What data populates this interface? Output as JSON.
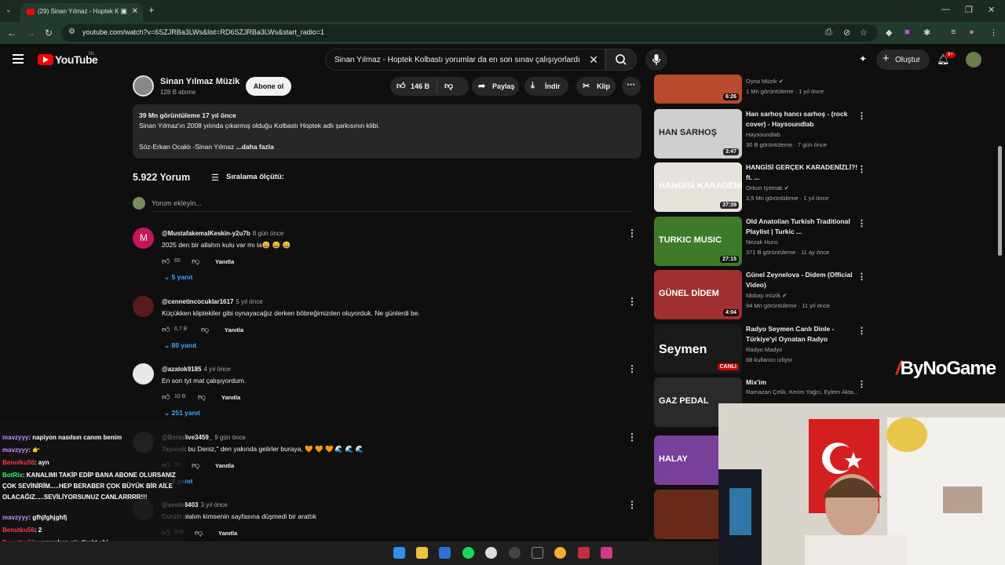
{
  "browser": {
    "tab_title": "(29) Sinan Yılmaz - Hoptek K",
    "url": "youtube.com/watch?v=6SZJRBa3LWs&list=RD6SZJRBa3LWs&start_radio=1"
  },
  "header": {
    "logo_text": "YouTube",
    "country": "NL",
    "search_query": "Sinan Yılmaz - Hoptek Kolbastı yorumlar da en son sınav çalışıyorlardı",
    "create_label": "Oluştur",
    "notif_count": "9+"
  },
  "channel": {
    "name": "Sinan Yılmaz Müzik",
    "subs": "128 B abone",
    "subscribe": "Abone ol",
    "likes": "146 B",
    "share": "Paylaş",
    "download": "İndir",
    "clip": "Klip"
  },
  "description": {
    "stats": "39 Mn görüntüleme  17 yıl önce",
    "line1": "Sinan Yılmaz'ın 2008 yılında çıkarmış olduğu  Kolbastı Hoptek adlı şarkısının klibi.",
    "line2": "Söz-Erkan Ocaklı -Sinan Yılmaz",
    "more": "...daha fazla"
  },
  "comments_section": {
    "count": "5.922 Yorum",
    "sort": "Sıralama ölçütü:",
    "add_placeholder": "Yorum ekleyin...",
    "reply_label": "Yanıtla"
  },
  "comments": [
    {
      "author": "@MustafakemalKeskin-y2u7b",
      "time": "8 gün önce",
      "text": "2025 den bir allahın kulu var mı la😄 😄 😄",
      "likes": "65",
      "replies": "5 yanıt",
      "avatar_color": "#c2185b",
      "avatar_letter": "M"
    },
    {
      "author": "@cennetincocuklar1617",
      "time": "5 yıl önce",
      "text": "Küçükken kliptekiler gibi oynayacağız derken böbreğimizden oluyorduk. Ne günlerdi be.",
      "likes": "6,7 B",
      "replies": "80 yanıt",
      "avatar_color": "#5a1a1a",
      "avatar_letter": ""
    },
    {
      "author": "@azatok9185",
      "time": "4 yıl önce",
      "text": "En son tyt mat çalışıyordum.",
      "likes": "10 B",
      "replies": "251 yanıt",
      "avatar_color": "#e8e8e8",
      "avatar_letter": ""
    },
    {
      "author": "@Bertolive3459_",
      "time": "9 gün önce",
      "text": "Taşacak bu Deniz,\" den yakında gelirler buraya, 🧡 🧡 🧡 🌊 🌊 🌊",
      "likes": "55",
      "replies": "4 yanıt",
      "avatar_color": "#444",
      "avatar_letter": ""
    },
    {
      "author": "@avolo8403",
      "time": "3 yıl önce",
      "text": "Dürüst olalım kimsenin sayfasına düşmedi bir arattık",
      "likes": "979",
      "replies": "",
      "avatar_color": "#333",
      "avatar_letter": ""
    }
  ],
  "sidebar_videos": [
    {
      "title": "",
      "channel": "Oyna Müzik",
      "verified": true,
      "meta": "1 Mn görüntüleme · 1 yıl önce",
      "duration": "6:26",
      "thumb_color": "#b94a2e",
      "thumb_text": ""
    },
    {
      "title": "Han sarhoş hancı sarhoş - (rock cover) - Haysoundlab",
      "channel": "Haysoundlab",
      "verified": false,
      "meta": "30 B görüntüleme · 7 gün önce",
      "duration": "3:47",
      "thumb_color": "#cfcfcf",
      "thumb_text": "HAN SARHOŞ"
    },
    {
      "title": "HANGİSİ GERÇEK KARADENİZLİ?! ft. ...",
      "channel": "Orkun Işıtmak",
      "verified": true,
      "meta": "3,5 Mn görüntüleme · 1 yıl önce",
      "duration": "37:39",
      "thumb_color": "#e8e2dc",
      "thumb_text": "HANGİSİ KARADENİZLİ"
    },
    {
      "title": "Old Anatolian Turkish Traditional Playlist | Turkic ...",
      "channel": "Nezak Huns",
      "verified": false,
      "meta": "371 B görüntüleme · 11 ay önce",
      "duration": "27:15",
      "thumb_color": "#3f7a2a",
      "thumb_text": "TURKIC MUSIC"
    },
    {
      "title": "Günel Zeynelova - Didem (Official Video)",
      "channel": "Idobay müzik",
      "verified": true,
      "meta": "94 Mn görüntüleme · 11 yıl önce",
      "duration": "4:04",
      "thumb_color": "#a03030",
      "thumb_text": "GÜNEL DİDEM"
    },
    {
      "title": "Radyo Seymen Canlı Dinle - Türkiye'yi Oynatan Radyo",
      "channel": "Radyo Madyo",
      "verified": false,
      "meta": "88 kullanıcı izliyor",
      "duration": "CANLI",
      "thumb_color": "#1a1a1a",
      "thumb_text": "Seymen"
    },
    {
      "title": "Mix'im",
      "channel": "Ramazan Çelik, Kerim Yağcı, Eylem Akta...",
      "verified": false,
      "meta": "",
      "duration": "",
      "thumb_color": "#2a2a2a",
      "thumb_text": "GAZ PEDAL"
    },
    {
      "title": "",
      "channel": "",
      "verified": false,
      "meta": "",
      "duration": "",
      "thumb_color": "#7a3f9a",
      "thumb_text": "HALAY"
    },
    {
      "title": "",
      "channel": "",
      "verified": false,
      "meta": "",
      "duration": "",
      "thumb_color": "#6a2a1a",
      "thumb_text": ""
    }
  ],
  "overlay": {
    "brand": "ByNoGame",
    "chat": [
      {
        "user": "mavzyyy",
        "msg": ": napiyon nasılsın canım benim",
        "cls": "up"
      },
      {
        "user": "mavzyyy",
        "msg": ": 👉",
        "cls": "up"
      },
      {
        "user": "Benutku56",
        "msg": ": ayn",
        "cls": "ub"
      },
      {
        "user": "BotRix",
        "msg": ": KANALIMI TAKİP EDİP BANA ABONE OLURSANIZ ÇOK SEVİNİRİM.....HEP BERABER ÇOK BÜYÜK BİR AİLE OLACAĞIZ.....SEVİLİYORSUNUZ CANLARRRR!!!",
        "cls": "ug"
      },
      {
        "user": "mavzyyy",
        "msg": ": gfhjfghjghfj",
        "cls": "up"
      },
      {
        "user": "Benutku56",
        "msg": ": 2",
        "cls": "ub"
      },
      {
        "user": "Benutku56",
        "msg": ": yorumlara gir direkt abi",
        "cls": "ub"
      }
    ]
  }
}
